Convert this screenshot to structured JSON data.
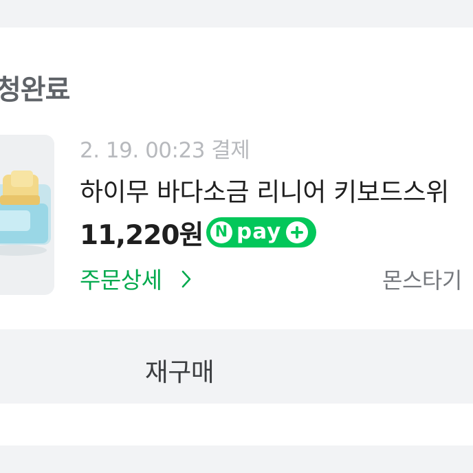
{
  "order": {
    "status_title": "청완료",
    "date": "2. 19. 00:23 결제",
    "product_name": "하이무 바다소금 리니어 키보드스위",
    "price": "11,220원",
    "payment_badge": {
      "logo_letter": "N",
      "text": "pay",
      "icon": "plus-icon",
      "color": "#03c75a"
    },
    "detail_link": "주문상세",
    "detail_icon": "chevron-right-icon",
    "seller": "몬스타기",
    "product_image": "keyboard-switch-image"
  },
  "actions": {
    "rebuy_label": "재구매"
  },
  "colors": {
    "background": "#f2f3f5",
    "card": "#ffffff",
    "accent_green": "#03a94d",
    "npay_green": "#03c75a"
  }
}
